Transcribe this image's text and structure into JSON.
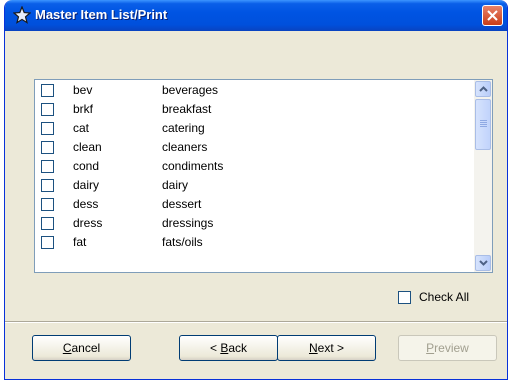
{
  "window": {
    "title": "Master Item List/Print"
  },
  "items": [
    {
      "code": "bev",
      "description": "beverages"
    },
    {
      "code": "brkf",
      "description": "breakfast"
    },
    {
      "code": "cat",
      "description": "catering"
    },
    {
      "code": "clean",
      "description": "cleaners"
    },
    {
      "code": "cond",
      "description": "condiments"
    },
    {
      "code": "dairy",
      "description": "dairy"
    },
    {
      "code": "dess",
      "description": "dessert"
    },
    {
      "code": "dress",
      "description": "dressings"
    },
    {
      "code": "fat",
      "description": "fats/oils"
    }
  ],
  "check_all": {
    "label": "Check All"
  },
  "buttons": {
    "cancel": {
      "mnemonic": "C",
      "rest": "ancel"
    },
    "back": {
      "prefix": "< ",
      "mnemonic": "B",
      "rest": "ack"
    },
    "next": {
      "mnemonic": "N",
      "rest": "ext >"
    },
    "preview": {
      "mnemonic": "P",
      "rest": "review"
    }
  }
}
